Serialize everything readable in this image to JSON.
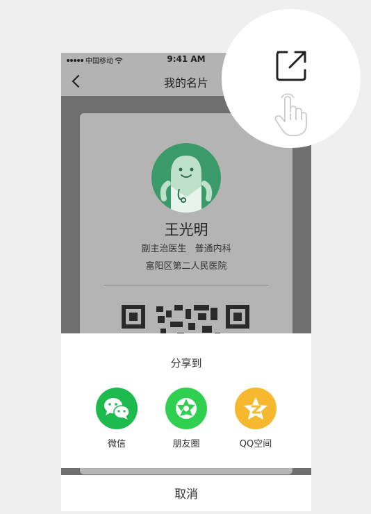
{
  "status_bar": {
    "carrier": "中国移动",
    "time": "9:41 AM"
  },
  "nav": {
    "title": "我的名片",
    "back_icon": "chevron-left-icon"
  },
  "card": {
    "name": "王光明",
    "position": "副主治医生",
    "department": "普通内科",
    "hospital": "富阳区第二人民医院"
  },
  "share_sheet": {
    "header": "分享到",
    "items": [
      {
        "label": "微信",
        "icon": "wechat-icon",
        "color": "#1dbb4d"
      },
      {
        "label": "朋友圈",
        "icon": "moments-icon",
        "color": "#2fd04f"
      },
      {
        "label": "QQ空间",
        "icon": "qzone-icon",
        "color": "#f5b82e"
      }
    ],
    "cancel": "取消"
  },
  "callout": {
    "icon": "share-external-icon",
    "gesture": "tap-hand-icon"
  },
  "colors": {
    "overlay": "#6f6f6f",
    "avatar": "#3b9a6a"
  }
}
